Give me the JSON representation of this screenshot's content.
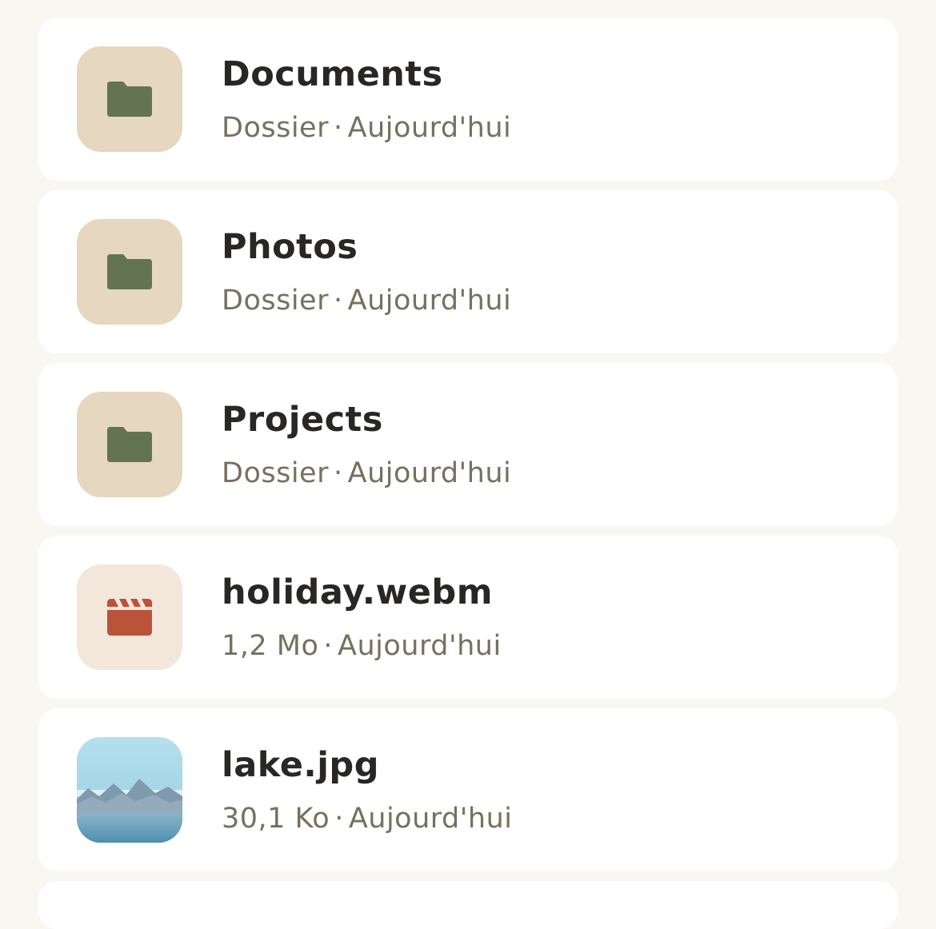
{
  "colors": {
    "background": "#f9f7f1",
    "card": "#ffffff",
    "folder_tile": "#e5d7c0",
    "folder_icon": "#637453",
    "video_tile": "#f3e7db",
    "video_icon": "#b9533a",
    "title_text": "#282725",
    "meta_text": "#77705f"
  },
  "files": [
    {
      "name": "Documents",
      "kind": "Dossier",
      "date": "Aujourd'hui",
      "icon": "folder-icon"
    },
    {
      "name": "Photos",
      "kind": "Dossier",
      "date": "Aujourd'hui",
      "icon": "folder-icon"
    },
    {
      "name": "Projects",
      "kind": "Dossier",
      "date": "Aujourd'hui",
      "icon": "folder-icon"
    },
    {
      "name": "holiday.webm",
      "kind": "1,2 Mo",
      "date": "Aujourd'hui",
      "icon": "clapperboard-icon"
    },
    {
      "name": "lake.jpg",
      "kind": "30,1 Ko",
      "date": "Aujourd'hui",
      "icon": "image-thumbnail"
    }
  ],
  "separator": "·"
}
